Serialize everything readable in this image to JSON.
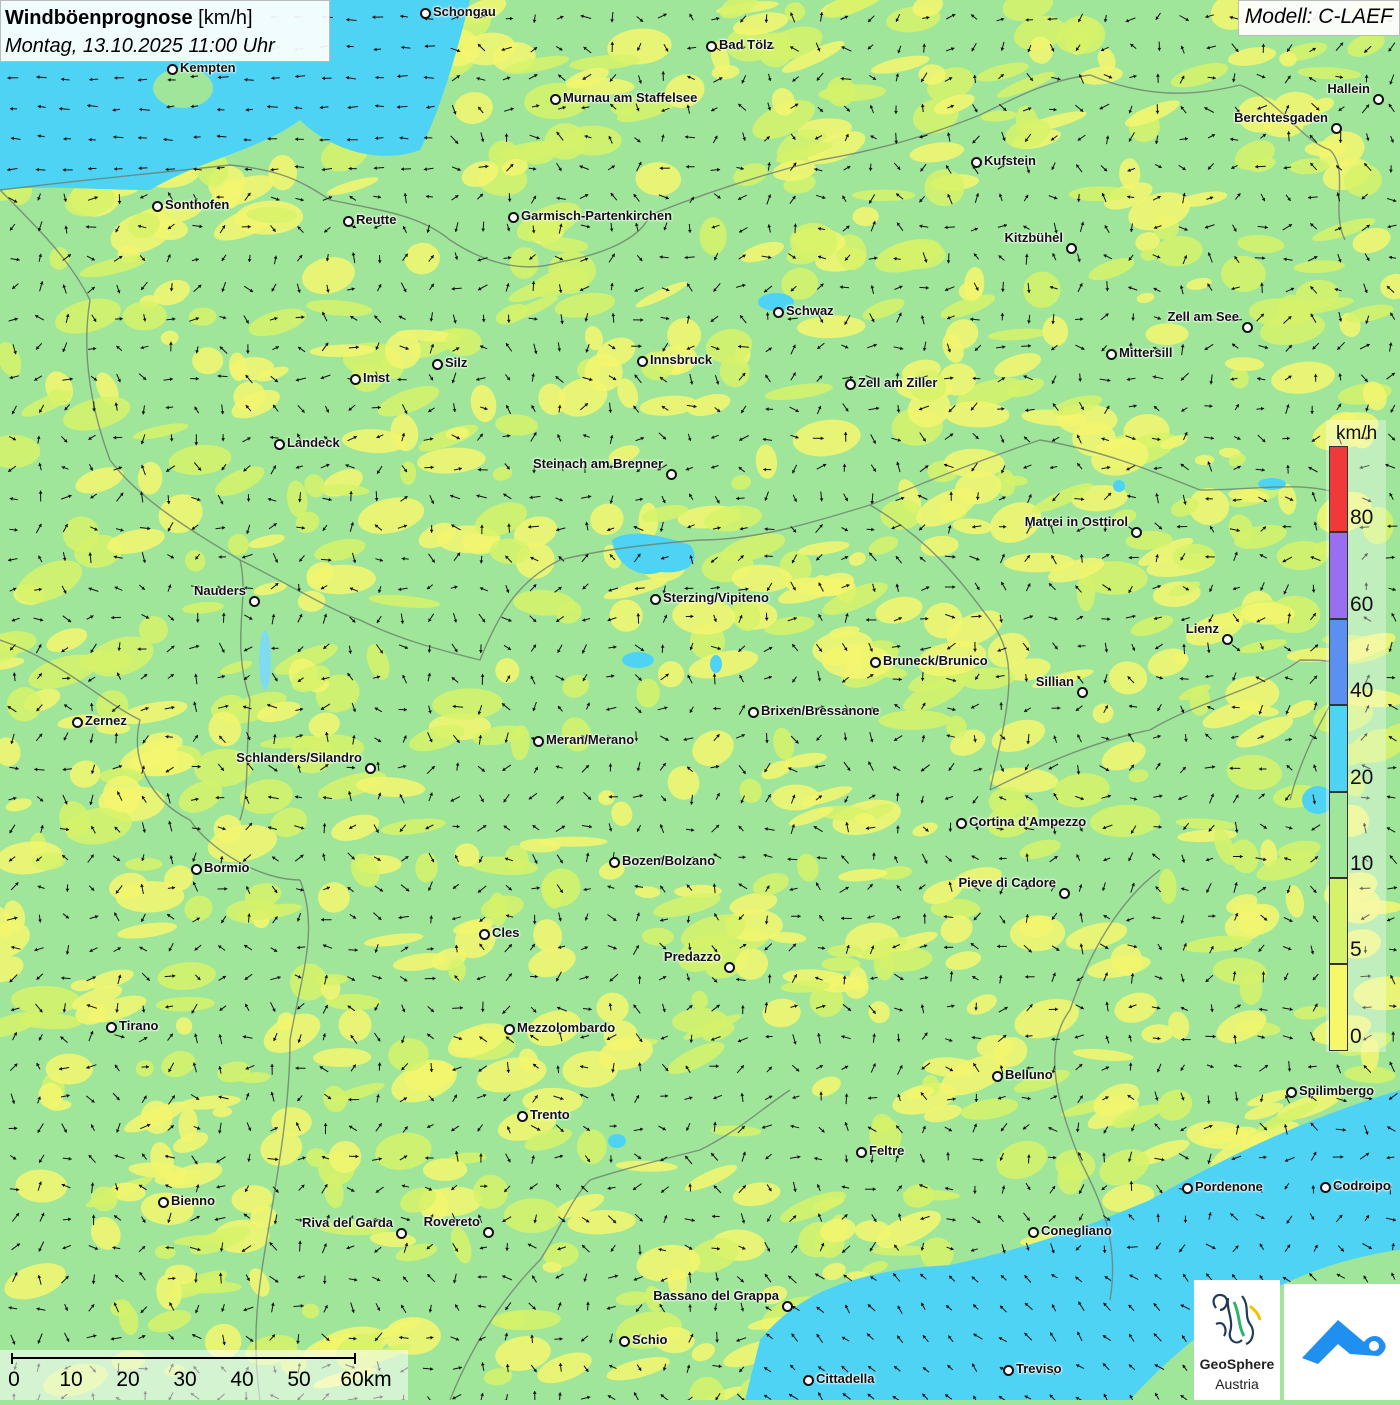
{
  "header": {
    "title_bold": "Windböenprognose",
    "title_unit": "[km/h]",
    "subtitle": "Montag, 13.10.2025 11:00 Uhr",
    "model": "Modell: C-LAEF"
  },
  "colors": {
    "calm_yellow": "#f6f86a",
    "yellowgreen": "#d6f26a",
    "green": "#9fe69a",
    "cyan": "#4fd3f5",
    "blue": "#5b8ff0",
    "purple": "#9a6ef0",
    "red": "#f03a3a",
    "arrow": "#111111"
  },
  "legend": {
    "unit": "km/h",
    "bands": [
      {
        "label": "0",
        "color": "#f6f86a"
      },
      {
        "label": "5",
        "color": "#d6f26a"
      },
      {
        "label": "10",
        "color": "#9fe69a"
      },
      {
        "label": "20",
        "color": "#4fd3f5"
      },
      {
        "label": "40",
        "color": "#5b8ff0"
      },
      {
        "label": "60",
        "color": "#9a6ef0"
      },
      {
        "label": "80",
        "color": "#f03a3a"
      }
    ]
  },
  "cities": [
    {
      "name": "Schongau"
    },
    {
      "name": "Bad Tölz"
    },
    {
      "name": "Kempten"
    },
    {
      "name": "Murnau am Staffelsee"
    },
    {
      "name": "Hallein"
    },
    {
      "name": "Berchtesgaden"
    },
    {
      "name": "Kufstein"
    },
    {
      "name": "Sonthofen"
    },
    {
      "name": "Reutte"
    },
    {
      "name": "Garmisch-Partenkirchen"
    },
    {
      "name": "Kitzbühel"
    },
    {
      "name": "Schwaz"
    },
    {
      "name": "Zell am See"
    },
    {
      "name": "Mittersill"
    },
    {
      "name": "Innsbruck"
    },
    {
      "name": "Silz"
    },
    {
      "name": "Imst"
    },
    {
      "name": "Zell am Ziller"
    },
    {
      "name": "Landeck"
    },
    {
      "name": "Steinach am Brenner"
    },
    {
      "name": "Matrei in Osttirol"
    },
    {
      "name": "Nauders"
    },
    {
      "name": "Sterzing/Vipiteno"
    },
    {
      "name": "Lienz"
    },
    {
      "name": "Bruneck/Brunico"
    },
    {
      "name": "Sillian"
    },
    {
      "name": "Zernez"
    },
    {
      "name": "Brixen/Bressanone"
    },
    {
      "name": "Meran/Merano"
    },
    {
      "name": "Schlanders/Silandro"
    },
    {
      "name": "Cortina d'Ampezzo"
    },
    {
      "name": "Bozen/Bolzano"
    },
    {
      "name": "Bormio"
    },
    {
      "name": "Pieve di Cadore"
    },
    {
      "name": "Cles"
    },
    {
      "name": "Predazzo"
    },
    {
      "name": "Tirano"
    },
    {
      "name": "Mezzolombardo"
    },
    {
      "name": "Belluno"
    },
    {
      "name": "Spilimbergo"
    },
    {
      "name": "Trento"
    },
    {
      "name": "Feltre"
    },
    {
      "name": "Bienno"
    },
    {
      "name": "Pordenone"
    },
    {
      "name": "Codroipo"
    },
    {
      "name": "Riva del Garda"
    },
    {
      "name": "Rovereto"
    },
    {
      "name": "Conegliano"
    },
    {
      "name": "Bassano del Grappa"
    },
    {
      "name": "Schio"
    },
    {
      "name": "Treviso"
    },
    {
      "name": "Cittadella"
    }
  ],
  "scale": {
    "labels": [
      "0",
      "10",
      "20",
      "30",
      "40",
      "50",
      "60km"
    ]
  },
  "logo": {
    "line1": "GeoSphere",
    "line2": "Austria"
  }
}
